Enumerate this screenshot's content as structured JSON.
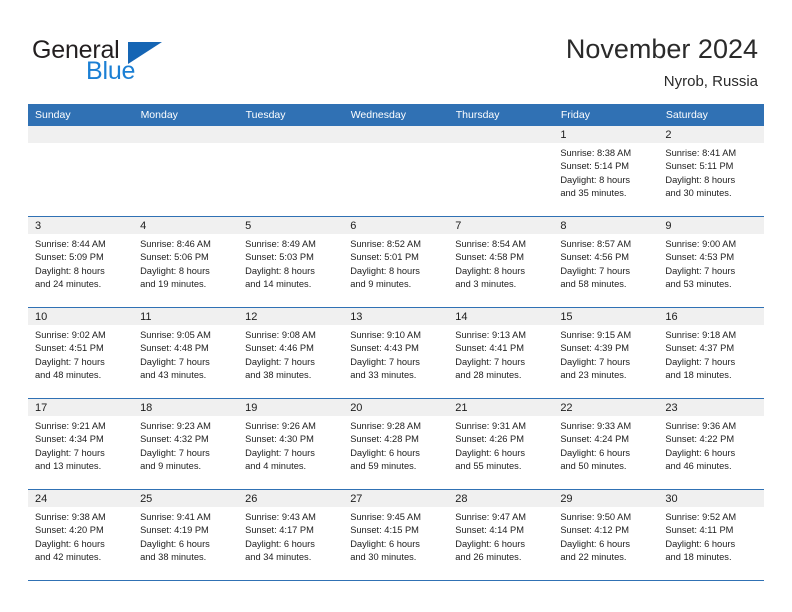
{
  "brand": {
    "name_part1": "General",
    "name_part2": "Blue",
    "triangle_color": "#1565b4",
    "blue_text_color": "#1b7fd4"
  },
  "header": {
    "title": "November 2024",
    "subtitle": "Nyrob, Russia",
    "accent_color": "#3071b4"
  },
  "calendar": {
    "weekday_headers": [
      "Sunday",
      "Monday",
      "Tuesday",
      "Wednesday",
      "Thursday",
      "Friday",
      "Saturday"
    ],
    "weeks": [
      [
        {
          "day": "",
          "empty": true,
          "sunrise": "",
          "sunset": "",
          "daylight_line1": "",
          "daylight_line2": ""
        },
        {
          "day": "",
          "empty": true,
          "sunrise": "",
          "sunset": "",
          "daylight_line1": "",
          "daylight_line2": ""
        },
        {
          "day": "",
          "empty": true,
          "sunrise": "",
          "sunset": "",
          "daylight_line1": "",
          "daylight_line2": ""
        },
        {
          "day": "",
          "empty": true,
          "sunrise": "",
          "sunset": "",
          "daylight_line1": "",
          "daylight_line2": ""
        },
        {
          "day": "",
          "empty": true,
          "sunrise": "",
          "sunset": "",
          "daylight_line1": "",
          "daylight_line2": ""
        },
        {
          "day": "1",
          "empty": false,
          "sunrise": "Sunrise: 8:38 AM",
          "sunset": "Sunset: 5:14 PM",
          "daylight_line1": "Daylight: 8 hours",
          "daylight_line2": "and 35 minutes."
        },
        {
          "day": "2",
          "empty": false,
          "sunrise": "Sunrise: 8:41 AM",
          "sunset": "Sunset: 5:11 PM",
          "daylight_line1": "Daylight: 8 hours",
          "daylight_line2": "and 30 minutes."
        }
      ],
      [
        {
          "day": "3",
          "empty": false,
          "sunrise": "Sunrise: 8:44 AM",
          "sunset": "Sunset: 5:09 PM",
          "daylight_line1": "Daylight: 8 hours",
          "daylight_line2": "and 24 minutes."
        },
        {
          "day": "4",
          "empty": false,
          "sunrise": "Sunrise: 8:46 AM",
          "sunset": "Sunset: 5:06 PM",
          "daylight_line1": "Daylight: 8 hours",
          "daylight_line2": "and 19 minutes."
        },
        {
          "day": "5",
          "empty": false,
          "sunrise": "Sunrise: 8:49 AM",
          "sunset": "Sunset: 5:03 PM",
          "daylight_line1": "Daylight: 8 hours",
          "daylight_line2": "and 14 minutes."
        },
        {
          "day": "6",
          "empty": false,
          "sunrise": "Sunrise: 8:52 AM",
          "sunset": "Sunset: 5:01 PM",
          "daylight_line1": "Daylight: 8 hours",
          "daylight_line2": "and 9 minutes."
        },
        {
          "day": "7",
          "empty": false,
          "sunrise": "Sunrise: 8:54 AM",
          "sunset": "Sunset: 4:58 PM",
          "daylight_line1": "Daylight: 8 hours",
          "daylight_line2": "and 3 minutes."
        },
        {
          "day": "8",
          "empty": false,
          "sunrise": "Sunrise: 8:57 AM",
          "sunset": "Sunset: 4:56 PM",
          "daylight_line1": "Daylight: 7 hours",
          "daylight_line2": "and 58 minutes."
        },
        {
          "day": "9",
          "empty": false,
          "sunrise": "Sunrise: 9:00 AM",
          "sunset": "Sunset: 4:53 PM",
          "daylight_line1": "Daylight: 7 hours",
          "daylight_line2": "and 53 minutes."
        }
      ],
      [
        {
          "day": "10",
          "empty": false,
          "sunrise": "Sunrise: 9:02 AM",
          "sunset": "Sunset: 4:51 PM",
          "daylight_line1": "Daylight: 7 hours",
          "daylight_line2": "and 48 minutes."
        },
        {
          "day": "11",
          "empty": false,
          "sunrise": "Sunrise: 9:05 AM",
          "sunset": "Sunset: 4:48 PM",
          "daylight_line1": "Daylight: 7 hours",
          "daylight_line2": "and 43 minutes."
        },
        {
          "day": "12",
          "empty": false,
          "sunrise": "Sunrise: 9:08 AM",
          "sunset": "Sunset: 4:46 PM",
          "daylight_line1": "Daylight: 7 hours",
          "daylight_line2": "and 38 minutes."
        },
        {
          "day": "13",
          "empty": false,
          "sunrise": "Sunrise: 9:10 AM",
          "sunset": "Sunset: 4:43 PM",
          "daylight_line1": "Daylight: 7 hours",
          "daylight_line2": "and 33 minutes."
        },
        {
          "day": "14",
          "empty": false,
          "sunrise": "Sunrise: 9:13 AM",
          "sunset": "Sunset: 4:41 PM",
          "daylight_line1": "Daylight: 7 hours",
          "daylight_line2": "and 28 minutes."
        },
        {
          "day": "15",
          "empty": false,
          "sunrise": "Sunrise: 9:15 AM",
          "sunset": "Sunset: 4:39 PM",
          "daylight_line1": "Daylight: 7 hours",
          "daylight_line2": "and 23 minutes."
        },
        {
          "day": "16",
          "empty": false,
          "sunrise": "Sunrise: 9:18 AM",
          "sunset": "Sunset: 4:37 PM",
          "daylight_line1": "Daylight: 7 hours",
          "daylight_line2": "and 18 minutes."
        }
      ],
      [
        {
          "day": "17",
          "empty": false,
          "sunrise": "Sunrise: 9:21 AM",
          "sunset": "Sunset: 4:34 PM",
          "daylight_line1": "Daylight: 7 hours",
          "daylight_line2": "and 13 minutes."
        },
        {
          "day": "18",
          "empty": false,
          "sunrise": "Sunrise: 9:23 AM",
          "sunset": "Sunset: 4:32 PM",
          "daylight_line1": "Daylight: 7 hours",
          "daylight_line2": "and 9 minutes."
        },
        {
          "day": "19",
          "empty": false,
          "sunrise": "Sunrise: 9:26 AM",
          "sunset": "Sunset: 4:30 PM",
          "daylight_line1": "Daylight: 7 hours",
          "daylight_line2": "and 4 minutes."
        },
        {
          "day": "20",
          "empty": false,
          "sunrise": "Sunrise: 9:28 AM",
          "sunset": "Sunset: 4:28 PM",
          "daylight_line1": "Daylight: 6 hours",
          "daylight_line2": "and 59 minutes."
        },
        {
          "day": "21",
          "empty": false,
          "sunrise": "Sunrise: 9:31 AM",
          "sunset": "Sunset: 4:26 PM",
          "daylight_line1": "Daylight: 6 hours",
          "daylight_line2": "and 55 minutes."
        },
        {
          "day": "22",
          "empty": false,
          "sunrise": "Sunrise: 9:33 AM",
          "sunset": "Sunset: 4:24 PM",
          "daylight_line1": "Daylight: 6 hours",
          "daylight_line2": "and 50 minutes."
        },
        {
          "day": "23",
          "empty": false,
          "sunrise": "Sunrise: 9:36 AM",
          "sunset": "Sunset: 4:22 PM",
          "daylight_line1": "Daylight: 6 hours",
          "daylight_line2": "and 46 minutes."
        }
      ],
      [
        {
          "day": "24",
          "empty": false,
          "sunrise": "Sunrise: 9:38 AM",
          "sunset": "Sunset: 4:20 PM",
          "daylight_line1": "Daylight: 6 hours",
          "daylight_line2": "and 42 minutes."
        },
        {
          "day": "25",
          "empty": false,
          "sunrise": "Sunrise: 9:41 AM",
          "sunset": "Sunset: 4:19 PM",
          "daylight_line1": "Daylight: 6 hours",
          "daylight_line2": "and 38 minutes."
        },
        {
          "day": "26",
          "empty": false,
          "sunrise": "Sunrise: 9:43 AM",
          "sunset": "Sunset: 4:17 PM",
          "daylight_line1": "Daylight: 6 hours",
          "daylight_line2": "and 34 minutes."
        },
        {
          "day": "27",
          "empty": false,
          "sunrise": "Sunrise: 9:45 AM",
          "sunset": "Sunset: 4:15 PM",
          "daylight_line1": "Daylight: 6 hours",
          "daylight_line2": "and 30 minutes."
        },
        {
          "day": "28",
          "empty": false,
          "sunrise": "Sunrise: 9:47 AM",
          "sunset": "Sunset: 4:14 PM",
          "daylight_line1": "Daylight: 6 hours",
          "daylight_line2": "and 26 minutes."
        },
        {
          "day": "29",
          "empty": false,
          "sunrise": "Sunrise: 9:50 AM",
          "sunset": "Sunset: 4:12 PM",
          "daylight_line1": "Daylight: 6 hours",
          "daylight_line2": "and 22 minutes."
        },
        {
          "day": "30",
          "empty": false,
          "sunrise": "Sunrise: 9:52 AM",
          "sunset": "Sunset: 4:11 PM",
          "daylight_line1": "Daylight: 6 hours",
          "daylight_line2": "and 18 minutes."
        }
      ]
    ]
  }
}
